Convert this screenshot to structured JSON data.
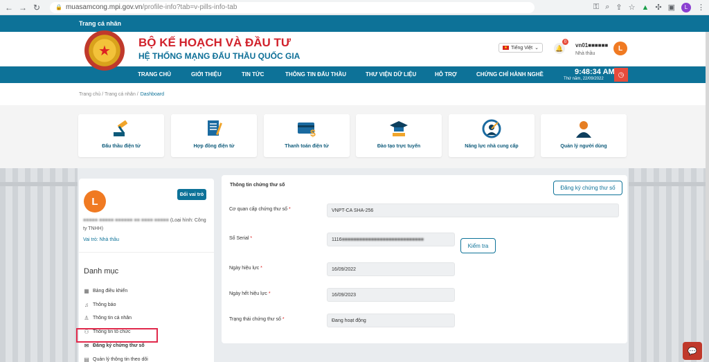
{
  "browser": {
    "url_domain": "muasamcong.mpi.gov.vn",
    "url_path": "/profile-info?tab=v-pills-info-tab",
    "profile_initial": "L"
  },
  "topbar": {
    "label": "Trang cá nhân"
  },
  "header": {
    "title": "BỘ KẾ HOẠCH VÀ ĐẦU TƯ",
    "subtitle": "HỆ THỐNG MẠNG ĐẤU THẦU QUỐC GIA",
    "language": "Tiếng Việt",
    "notifications": "0",
    "username": "vn01■■■■■■",
    "user_role": "Nhà thầu",
    "avatar_initial": "L"
  },
  "menu": {
    "items": [
      "TRANG CHỦ",
      "GIỚI THIỆU",
      "TIN TỨC",
      "THÔNG TIN ĐẤU THẦU",
      "THƯ VIỆN DỮ LIỆU",
      "HỖ TRỢ",
      "CHỨNG CHỈ HÀNH NGHỀ"
    ],
    "time": "9:48:34 AM",
    "date": "Thứ năm, 22/09/2022"
  },
  "breadcrumb": {
    "trail": "Trang chủ / Trang cá nhân /",
    "current": "Dashboard"
  },
  "tiles": [
    {
      "label": "Đấu thầu điện tử"
    },
    {
      "label": "Hợp đồng điện tử"
    },
    {
      "label": "Thanh toán điện tử"
    },
    {
      "label": "Đào tạo trực tuyến"
    },
    {
      "label": "Năng lực nhà cung cấp"
    },
    {
      "label": "Quản lý người dùng"
    }
  ],
  "profile": {
    "avatar_initial": "L",
    "switch_role": "Đổi vai trò",
    "org_name_blur": "■■■■■ ■■■■■ ■■■■■■ ■■ ■■■■ ■■■■■",
    "org_type": "(Loại hình: Công ty TNHH)",
    "role": "Vai trò: Nhà thầu"
  },
  "sidebar": {
    "heading": "Danh mục",
    "items": [
      {
        "label": "Bảng điều khiển"
      },
      {
        "label": "Thông báo"
      },
      {
        "label": "Thông tin cá nhân"
      },
      {
        "label": "Thông tin tổ chức"
      },
      {
        "label": "Đăng ký chứng thư số"
      },
      {
        "label": "Quản lý thông tin theo dõi"
      }
    ]
  },
  "cert": {
    "section_title": "Thông tin chứng thư số",
    "register_button": "Đăng ký chứng thư số",
    "fields": {
      "issuer_label": "Cơ quan cấp chứng thư số",
      "issuer_value": "VNPT-CA SHA-256",
      "serial_label": "Số Serial",
      "serial_prefix": "1116",
      "serial_blur": "■■■■■■■■■■■■■■■■■■■■■■■■■■■■",
      "check_button": "Kiểm tra",
      "valid_from_label": "Ngày hiệu lực",
      "valid_from_value": "16/09/2022",
      "valid_to_label": "Ngày hết hiệu lực",
      "valid_to_value": "16/09/2023",
      "status_label": "Trạng thái chứng thư số",
      "status_value": "Đang hoạt động",
      "required_mark": "*"
    }
  },
  "icons": {
    "back": "arrow-left-icon",
    "forward": "arrow-right-icon",
    "reload": "reload-icon",
    "lock": "lock-icon",
    "chat": "chat-icon"
  }
}
